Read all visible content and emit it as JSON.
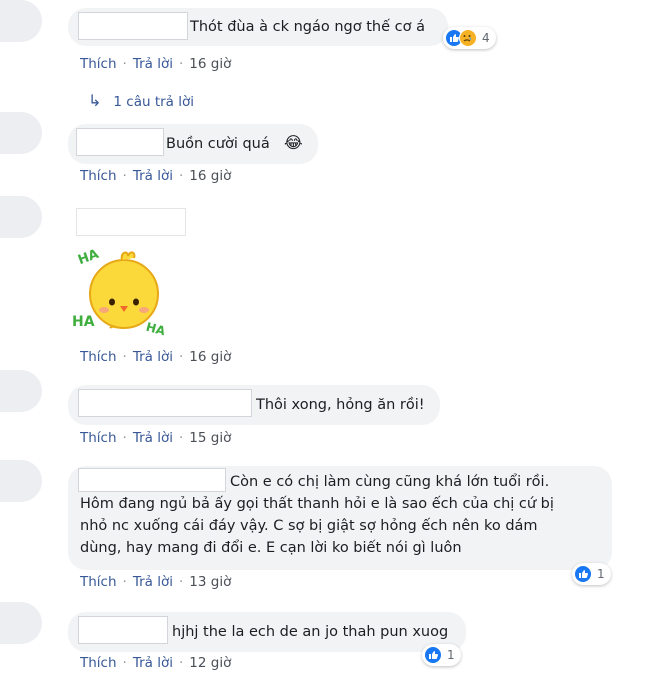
{
  "comments": [
    {
      "text": "Thót đùa à ck ngáo ngơ thế cơ á",
      "actions": {
        "like": "Thích",
        "reply": "Trả lời",
        "time": "16 giờ"
      },
      "reactions": {
        "count": "4"
      }
    },
    {
      "text": "Buồn cười quá",
      "emoji": "😂",
      "actions": {
        "like": "Thích",
        "reply": "Trả lời",
        "time": "16 giờ"
      }
    },
    {
      "sticker": {
        "ha_top": "HA",
        "ha_left": "HA",
        "ha_right": "HA"
      },
      "actions": {
        "like": "Thích",
        "reply": "Trả lời",
        "time": "16 giờ"
      }
    },
    {
      "text": "Thôi xong, hỏng ăn rồi!",
      "actions": {
        "like": "Thích",
        "reply": "Trả lời",
        "time": "15 giờ"
      }
    },
    {
      "lines": [
        "Còn e có chị làm cùng cũng khá lớn tuổi rồi.",
        "Hôm đang ngủ bả ấy gọi thất thanh hỏi e là sao ếch của chị cứ bị",
        "nhỏ nc xuống cái đáy vậy. C sợ bị giật sợ hỏng ếch nên ko dám",
        "dùng, hay mang đi đổi e. E cạn lời ko biết nói gì luôn"
      ],
      "actions": {
        "like": "Thích",
        "reply": "Trả lời",
        "time": "13 giờ"
      },
      "reactions": {
        "count": "1"
      }
    },
    {
      "text": "hjhj the la ech de an jo thah pun xuog",
      "actions": {
        "like": "Thích",
        "reply": "Trả lời",
        "time": "12 giờ"
      },
      "reactions": {
        "count": "1"
      }
    }
  ],
  "replies_link": {
    "arrow": "↳",
    "label": "1 câu trả lời"
  },
  "separator": "·"
}
